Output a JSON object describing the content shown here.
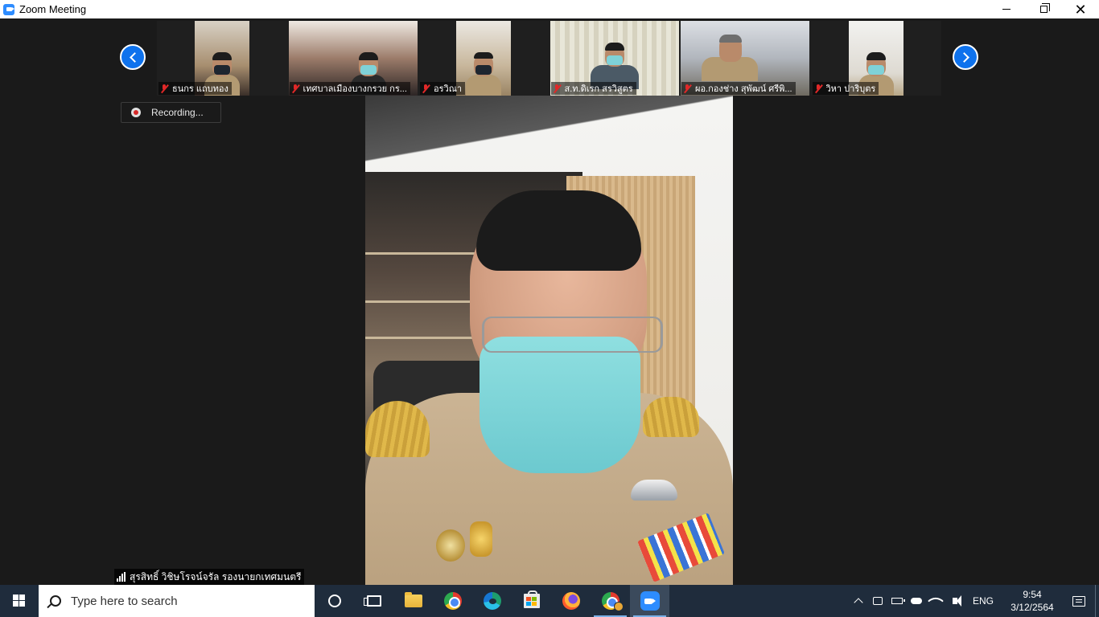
{
  "window": {
    "title": "Zoom Meeting"
  },
  "gallery": {
    "participants": [
      {
        "name": "ธนกร แถบทอง",
        "muted": true
      },
      {
        "name": "เทศบาลเมืองบางกรวย กร...",
        "muted": true
      },
      {
        "name": "อรวิณา",
        "muted": true
      },
      {
        "name": "ส.ท.ดิเรก สรวิสูตร",
        "muted": true
      },
      {
        "name": "ผอ.กองช่าง สุพัฒน์ ศรีพิ...",
        "muted": true
      },
      {
        "name": "วิหา ปาริบุตร",
        "muted": true
      }
    ]
  },
  "recording": {
    "label": "Recording..."
  },
  "active_speaker": {
    "name": "สุรสิทธิ์ วิชิษโรจน์จรัล รองนายกเทศมนตรี"
  },
  "taskbar": {
    "search_placeholder": "Type here to search",
    "language": "ENG",
    "time": "9:54",
    "date": "3/12/2564"
  },
  "colors": {
    "accent": "#0e72ed",
    "zoom_blue": "#2d8cff",
    "muted_red": "#e02828",
    "taskbar_bg": "#1f2c3c"
  }
}
